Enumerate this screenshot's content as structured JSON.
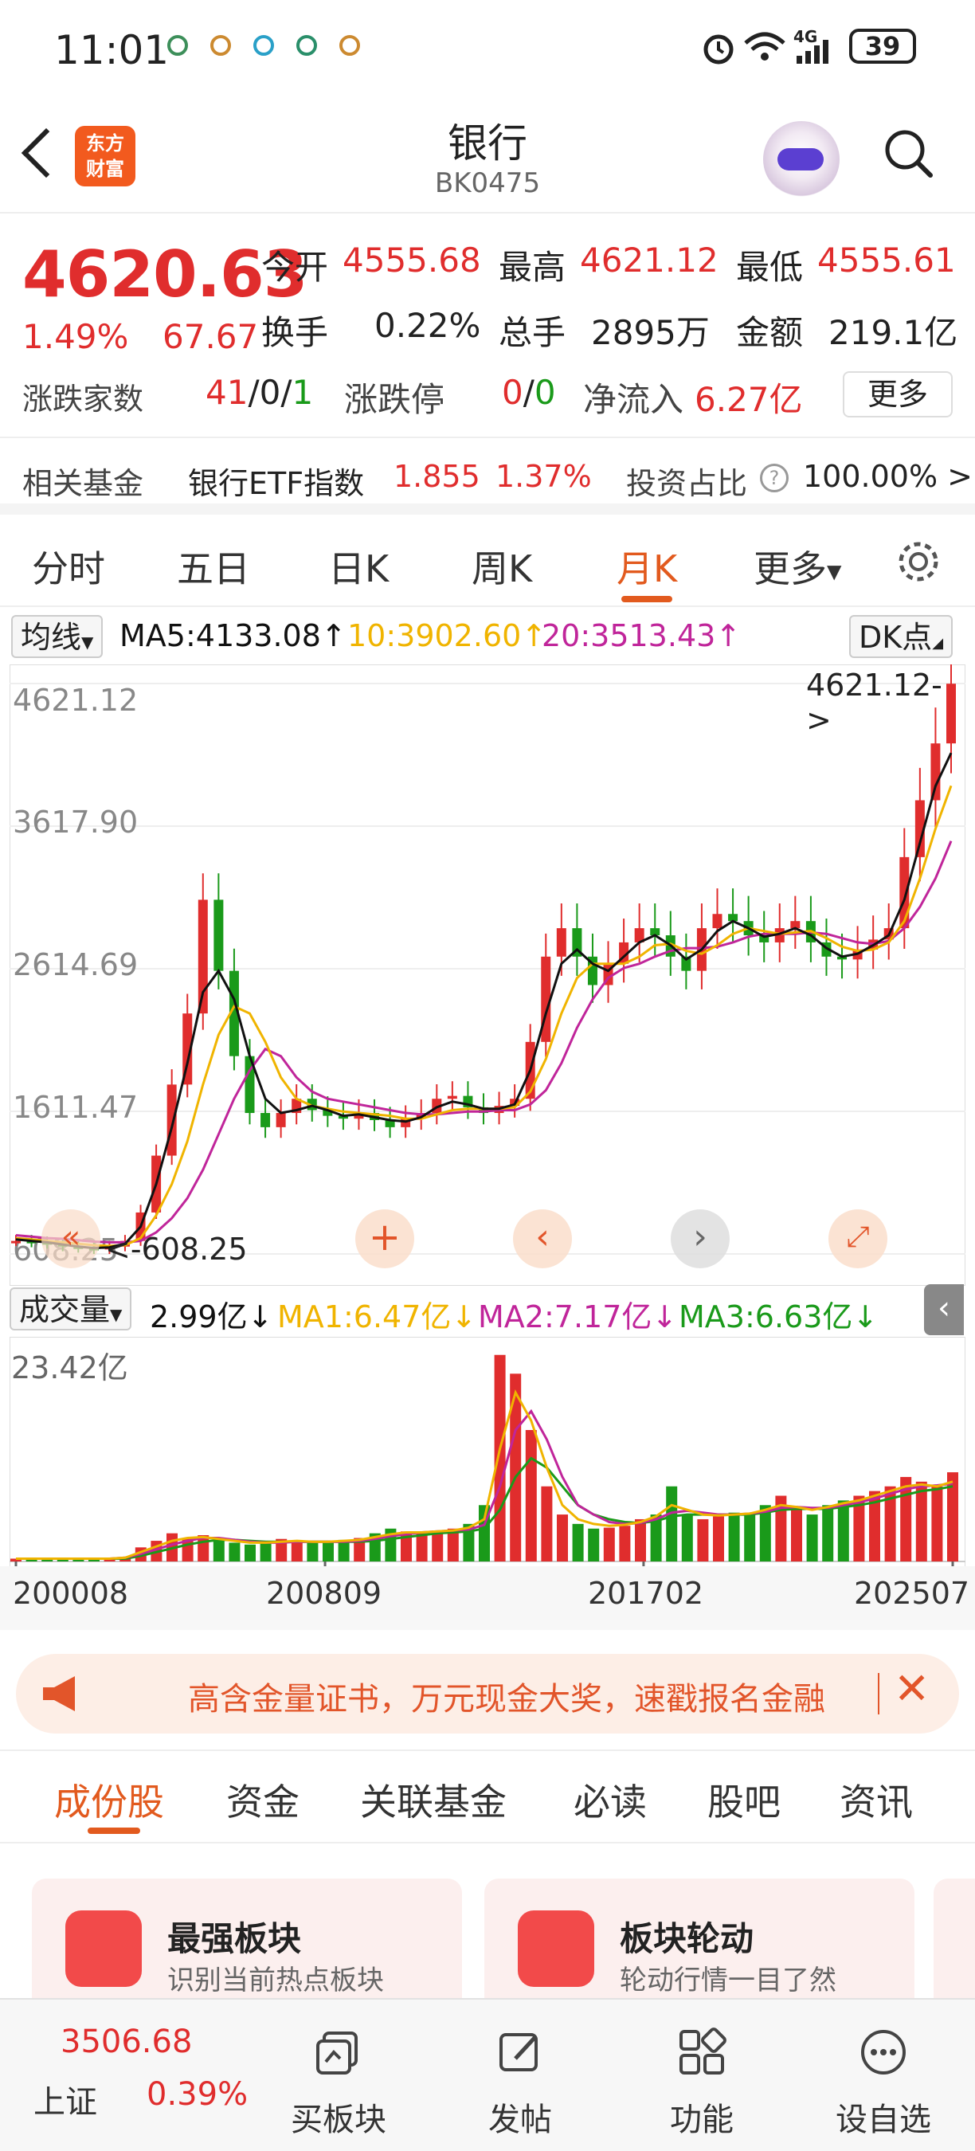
{
  "status": {
    "time": "11:01",
    "network": "4G",
    "battery": "39"
  },
  "header": {
    "back": "back",
    "logo_line1": "东方",
    "logo_line2": "财富",
    "title": "银行",
    "code": "BK0475"
  },
  "quote": {
    "price": "4620.63",
    "change_pct": "1.49%",
    "change": "67.67",
    "open_label": "今开",
    "open": "4555.68",
    "high_label": "最高",
    "high": "4621.12",
    "low_label": "最低",
    "low": "4555.61",
    "turnover_label": "换手",
    "turnover": "0.22%",
    "volume_label": "总手",
    "volume": "2895万",
    "amount_label": "金额",
    "amount": "219.1亿",
    "updown_label": "涨跌家数",
    "up": "41",
    "flat": "0",
    "down": "1",
    "limit_label": "涨跌停",
    "limit_up": "0",
    "limit_down": "0",
    "inflow_label": "净流入",
    "inflow": "6.27亿",
    "more": "更多"
  },
  "fund": {
    "label": "相关基金",
    "name": "银行ETF指数",
    "price": "1.855",
    "pct": "1.37%",
    "ratio_label": "投资占比",
    "ratio": "100.00% >"
  },
  "tabs": [
    "分时",
    "五日",
    "日K",
    "周K",
    "月K",
    "更多"
  ],
  "ma": {
    "select": "均线",
    "ma5": "MA5:4133.08↑",
    "ma10": "10:3902.60↑",
    "ma20": "20:3513.43↑",
    "dk": "DK点"
  },
  "chart_data": {
    "type": "candlestick",
    "period": "monthly",
    "x_ticks": [
      "200008",
      "200809",
      "201702",
      "202507"
    ],
    "y_ticks": [
      4621.12,
      3617.9,
      2614.69,
      1611.47,
      608.25
    ],
    "y_tick_labels": [
      "4621.12",
      "3617.90",
      "2614.69",
      "1611.47",
      "608.25"
    ],
    "max_label": "4621.12->",
    "min_label": "<-608.25",
    "close_series": [
      700,
      690,
      680,
      660,
      650,
      640,
      660,
      700,
      900,
      1300,
      1800,
      2300,
      3100,
      2600,
      2000,
      1600,
      1500,
      1600,
      1700,
      1620,
      1580,
      1560,
      1600,
      1550,
      1500,
      1560,
      1600,
      1700,
      1720,
      1640,
      1600,
      1650,
      1700,
      2100,
      2700,
      2900,
      2700,
      2500,
      2650,
      2800,
      2900,
      2850,
      2700,
      2600,
      2900,
      3000,
      2950,
      2850,
      2800,
      2900,
      2950,
      2800,
      2700,
      2680,
      2750,
      2820,
      2900,
      3400,
      3800,
      4200,
      4620
    ],
    "ma5_series": [
      710,
      700,
      690,
      675,
      660,
      650,
      655,
      680,
      800,
      1100,
      1500,
      1950,
      2450,
      2600,
      2400,
      2000,
      1700,
      1600,
      1620,
      1650,
      1620,
      1580,
      1590,
      1570,
      1550,
      1540,
      1570,
      1640,
      1680,
      1660,
      1630,
      1630,
      1660,
      1900,
      2300,
      2650,
      2750,
      2650,
      2600,
      2700,
      2800,
      2850,
      2780,
      2680,
      2750,
      2880,
      2950,
      2900,
      2840,
      2860,
      2900,
      2850,
      2760,
      2700,
      2720,
      2780,
      2850,
      3100,
      3500,
      3900,
      4133
    ],
    "ma10_series": [
      720,
      710,
      700,
      690,
      680,
      670,
      665,
      670,
      720,
      880,
      1100,
      1400,
      1800,
      2150,
      2350,
      2300,
      2100,
      1850,
      1700,
      1650,
      1630,
      1610,
      1600,
      1590,
      1580,
      1560,
      1560,
      1590,
      1620,
      1630,
      1630,
      1630,
      1640,
      1750,
      1980,
      2300,
      2550,
      2650,
      2650,
      2650,
      2700,
      2780,
      2790,
      2740,
      2720,
      2780,
      2860,
      2900,
      2880,
      2860,
      2870,
      2880,
      2830,
      2770,
      2740,
      2750,
      2800,
      2950,
      3250,
      3600,
      3902
    ],
    "ma20_series": [
      740,
      730,
      720,
      715,
      705,
      695,
      690,
      690,
      700,
      760,
      860,
      1000,
      1200,
      1450,
      1700,
      1900,
      2050,
      2000,
      1850,
      1750,
      1700,
      1680,
      1660,
      1640,
      1620,
      1600,
      1590,
      1590,
      1600,
      1610,
      1610,
      1620,
      1620,
      1660,
      1760,
      1950,
      2200,
      2400,
      2550,
      2620,
      2650,
      2700,
      2740,
      2760,
      2760,
      2770,
      2800,
      2840,
      2860,
      2860,
      2860,
      2870,
      2860,
      2830,
      2800,
      2790,
      2810,
      2900,
      3050,
      3250,
      3513
    ]
  },
  "vol": {
    "select": "成交量",
    "value": "2.99亿↓",
    "ma1": "MA1:6.47亿↓",
    "ma2": "MA2:7.17亿↓",
    "ma3": "MA3:6.63亿↓",
    "max_label": "23.42亿"
  },
  "vol_data": {
    "max": 23.42,
    "values": [
      0.3,
      0.3,
      0.3,
      0.3,
      0.3,
      0.3,
      0.3,
      0.4,
      1.5,
      2.2,
      3.0,
      2.5,
      2.8,
      2.3,
      2.0,
      1.8,
      2.0,
      2.4,
      2.2,
      2.0,
      2.1,
      2.3,
      2.5,
      3.0,
      3.5,
      3.2,
      3.0,
      3.3,
      3.5,
      4.0,
      6.0,
      22.0,
      20.0,
      14.0,
      8.0,
      5.0,
      4.0,
      3.5,
      3.6,
      3.8,
      4.5,
      5.0,
      8.0,
      5.0,
      4.5,
      4.8,
      5.2,
      5.0,
      6.0,
      7.0,
      5.5,
      5.0,
      6.0,
      6.5,
      7.0,
      7.5,
      8.0,
      9.0,
      8.5,
      8.0,
      9.5
    ],
    "ma1": [
      0.3,
      0.3,
      0.3,
      0.3,
      0.3,
      0.3,
      0.3,
      0.4,
      1.0,
      1.6,
      2.2,
      2.5,
      2.6,
      2.4,
      2.2,
      2.0,
      2.0,
      2.1,
      2.2,
      2.1,
      2.1,
      2.2,
      2.3,
      2.6,
      2.9,
      3.1,
      3.1,
      3.2,
      3.3,
      3.6,
      4.5,
      12.0,
      18.0,
      15.0,
      10.0,
      6.0,
      4.5,
      4.0,
      3.8,
      3.9,
      4.2,
      4.8,
      6.0,
      5.5,
      5.0,
      4.9,
      5.0,
      5.1,
      5.5,
      6.0,
      5.8,
      5.5,
      5.8,
      6.2,
      6.5,
      7.0,
      7.5,
      8.0,
      8.2,
      8.0,
      8.5
    ],
    "ma2": [
      0.3,
      0.3,
      0.3,
      0.3,
      0.3,
      0.3,
      0.3,
      0.4,
      0.8,
      1.3,
      1.8,
      2.2,
      2.5,
      2.5,
      2.3,
      2.1,
      2.0,
      2.0,
      2.1,
      2.1,
      2.1,
      2.1,
      2.2,
      2.4,
      2.7,
      2.9,
      3.1,
      3.2,
      3.3,
      3.4,
      3.9,
      8.0,
      14.0,
      16.0,
      13.0,
      9.0,
      6.0,
      5.0,
      4.2,
      4.0,
      4.1,
      4.5,
      5.2,
      5.4,
      5.2,
      5.0,
      5.0,
      5.1,
      5.3,
      5.7,
      5.8,
      5.7,
      5.7,
      6.0,
      6.3,
      6.7,
      7.2,
      7.7,
      8.0,
      8.1,
      8.3
    ],
    "ma3": [
      0.3,
      0.3,
      0.3,
      0.3,
      0.3,
      0.3,
      0.3,
      0.3,
      0.6,
      1.0,
      1.4,
      1.8,
      2.1,
      2.3,
      2.3,
      2.2,
      2.1,
      2.1,
      2.1,
      2.1,
      2.1,
      2.1,
      2.1,
      2.2,
      2.4,
      2.6,
      2.8,
      3.0,
      3.1,
      3.2,
      3.5,
      5.5,
      9.0,
      11.0,
      10.0,
      8.0,
      6.0,
      5.0,
      4.5,
      4.2,
      4.1,
      4.3,
      4.8,
      5.0,
      5.0,
      5.0,
      5.0,
      5.0,
      5.2,
      5.5,
      5.6,
      5.6,
      5.6,
      5.8,
      6.0,
      6.3,
      6.7,
      7.1,
      7.5,
      7.7,
      8.0
    ]
  },
  "dates": [
    "200008",
    "200809",
    "201702",
    "202507"
  ],
  "banner": {
    "text": "高含金量证书，万元现金大奖，速戳报名金融"
  },
  "subtabs": [
    "成份股",
    "资金",
    "关联基金",
    "必读",
    "股吧",
    "资讯"
  ],
  "cards": [
    {
      "title": "最强板块",
      "sub": "识别当前热点板块"
    },
    {
      "title": "板块轮动",
      "sub": "轮动行情一目了然"
    }
  ],
  "bottom": {
    "index_price": "3506.68",
    "index_name": "上证",
    "index_pct": "0.39%",
    "items": [
      "买板块",
      "发帖",
      "功能",
      "设自选"
    ]
  },
  "colors": {
    "up": "#e02d2d",
    "down": "#1a9a1a",
    "ma5": "#111111",
    "ma10": "#f0b400",
    "ma20": "#c0259a",
    "accent": "#e25a1e"
  }
}
